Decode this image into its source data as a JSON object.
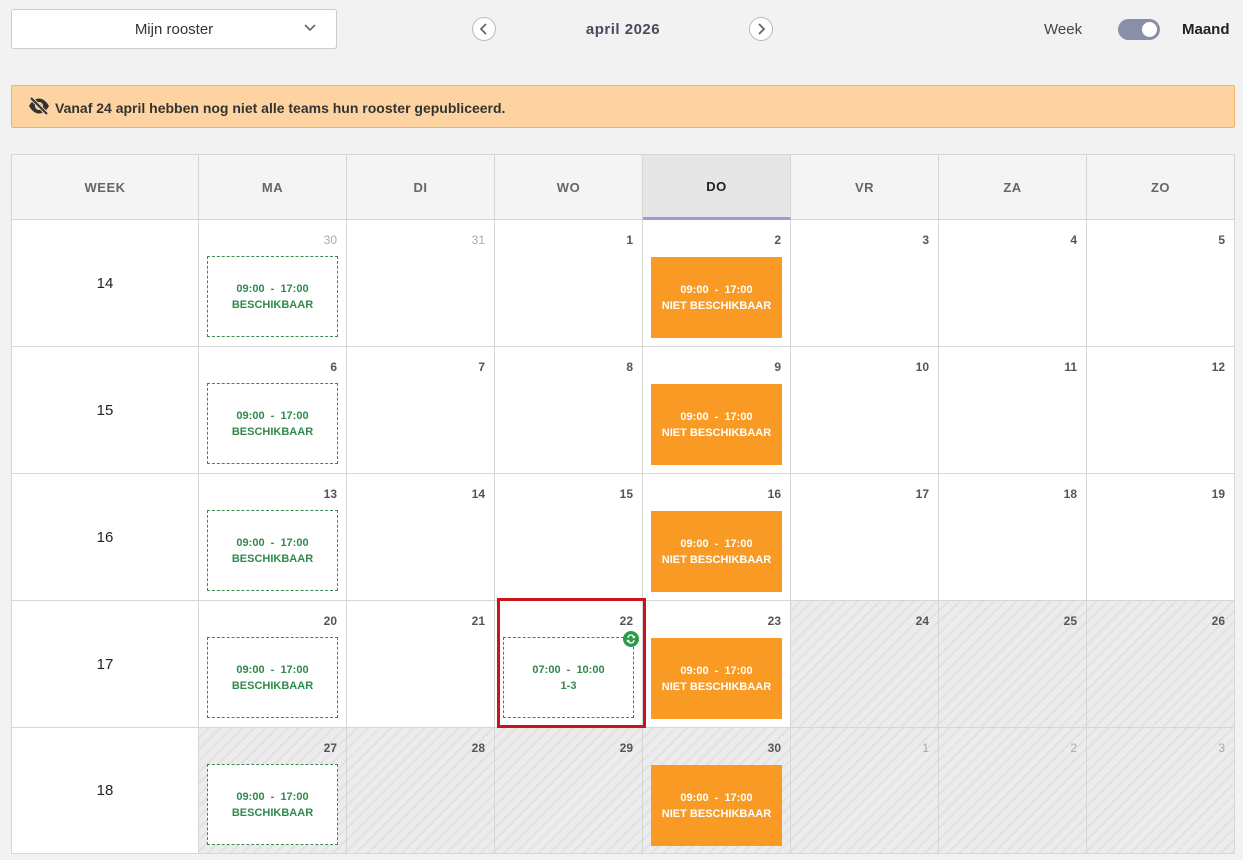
{
  "header": {
    "schedule_select": "Mijn rooster",
    "month_title": "april 2026",
    "view_week": "Week",
    "view_month": "Maand"
  },
  "alert": {
    "text": "Vanaf 24 april hebben nog niet alle teams hun rooster gepubliceerd."
  },
  "calendar": {
    "headers": [
      "WEEK",
      "MA",
      "DI",
      "WO",
      "DO",
      "VR",
      "ZA",
      "ZO"
    ],
    "today_column": "DO",
    "weeks": [
      {
        "week": "14",
        "days": [
          {
            "num": "30",
            "muted": true,
            "out": false,
            "shift": {
              "time": "09:00  -  17:00",
              "label": "BESCHIKBAAR",
              "kind": "available"
            }
          },
          {
            "num": "31",
            "muted": true,
            "out": false
          },
          {
            "num": "1",
            "muted": false,
            "out": false
          },
          {
            "num": "2",
            "muted": false,
            "out": false,
            "shift": {
              "time": "09:00  -  17:00",
              "label": "NIET BESCHIKBAAR",
              "kind": "unavailable"
            }
          },
          {
            "num": "3",
            "muted": false,
            "out": false
          },
          {
            "num": "4",
            "muted": false,
            "out": false
          },
          {
            "num": "5",
            "muted": false,
            "out": false
          }
        ]
      },
      {
        "week": "15",
        "days": [
          {
            "num": "6",
            "muted": false,
            "out": false,
            "shift": {
              "time": "09:00  -  17:00",
              "label": "BESCHIKBAAR",
              "kind": "available"
            }
          },
          {
            "num": "7",
            "muted": false,
            "out": false
          },
          {
            "num": "8",
            "muted": false,
            "out": false
          },
          {
            "num": "9",
            "muted": false,
            "out": false,
            "shift": {
              "time": "09:00  -  17:00",
              "label": "NIET BESCHIKBAAR",
              "kind": "unavailable"
            }
          },
          {
            "num": "10",
            "muted": false,
            "out": false
          },
          {
            "num": "11",
            "muted": false,
            "out": false
          },
          {
            "num": "12",
            "muted": false,
            "out": false
          }
        ]
      },
      {
        "week": "16",
        "days": [
          {
            "num": "13",
            "muted": false,
            "out": false,
            "shift": {
              "time": "09:00  -  17:00",
              "label": "BESCHIKBAAR",
              "kind": "available"
            }
          },
          {
            "num": "14",
            "muted": false,
            "out": false
          },
          {
            "num": "15",
            "muted": false,
            "out": false
          },
          {
            "num": "16",
            "muted": false,
            "out": false,
            "shift": {
              "time": "09:00  -  17:00",
              "label": "NIET BESCHIKBAAR",
              "kind": "unavailable"
            }
          },
          {
            "num": "17",
            "muted": false,
            "out": false
          },
          {
            "num": "18",
            "muted": false,
            "out": false
          },
          {
            "num": "19",
            "muted": false,
            "out": false
          }
        ]
      },
      {
        "week": "17",
        "days": [
          {
            "num": "20",
            "muted": false,
            "out": false,
            "shift": {
              "time": "09:00  -  17:00",
              "label": "BESCHIKBAAR",
              "kind": "available"
            }
          },
          {
            "num": "21",
            "muted": false,
            "out": false
          },
          {
            "num": "22",
            "muted": false,
            "out": false,
            "shift": {
              "time": "07:00  -  10:00",
              "label": "1-3",
              "kind": "available",
              "badge": true
            }
          },
          {
            "num": "23",
            "muted": false,
            "out": false,
            "shift": {
              "time": "09:00  -  17:00",
              "label": "NIET BESCHIKBAAR",
              "kind": "unavailable"
            }
          },
          {
            "num": "24",
            "muted": false,
            "out": true
          },
          {
            "num": "25",
            "muted": false,
            "out": true
          },
          {
            "num": "26",
            "muted": false,
            "out": true
          }
        ]
      },
      {
        "week": "18",
        "days": [
          {
            "num": "27",
            "muted": false,
            "out": true,
            "shift": {
              "time": "09:00  -  17:00",
              "label": "BESCHIKBAAR",
              "kind": "available"
            }
          },
          {
            "num": "28",
            "muted": false,
            "out": true
          },
          {
            "num": "29",
            "muted": false,
            "out": true
          },
          {
            "num": "30",
            "muted": false,
            "out": true,
            "shift": {
              "time": "09:00  -  17:00",
              "label": "NIET BESCHIKBAAR",
              "kind": "unavailable"
            }
          },
          {
            "num": "1",
            "muted": true,
            "out": true
          },
          {
            "num": "2",
            "muted": true,
            "out": true
          },
          {
            "num": "3",
            "muted": true,
            "out": true
          }
        ]
      }
    ]
  },
  "colors": {
    "alert_bg": "#fdd4a1",
    "available": "#2f8a4c",
    "unavailable": "#f99a25",
    "today_underline": "#9b9bd6",
    "highlight": "#c8141a"
  },
  "icons": {
    "select": "chevron-down-icon",
    "prev": "chevron-left-icon",
    "next": "chevron-right-icon",
    "alert": "eye-slash-icon",
    "badge": "swap-icon"
  }
}
